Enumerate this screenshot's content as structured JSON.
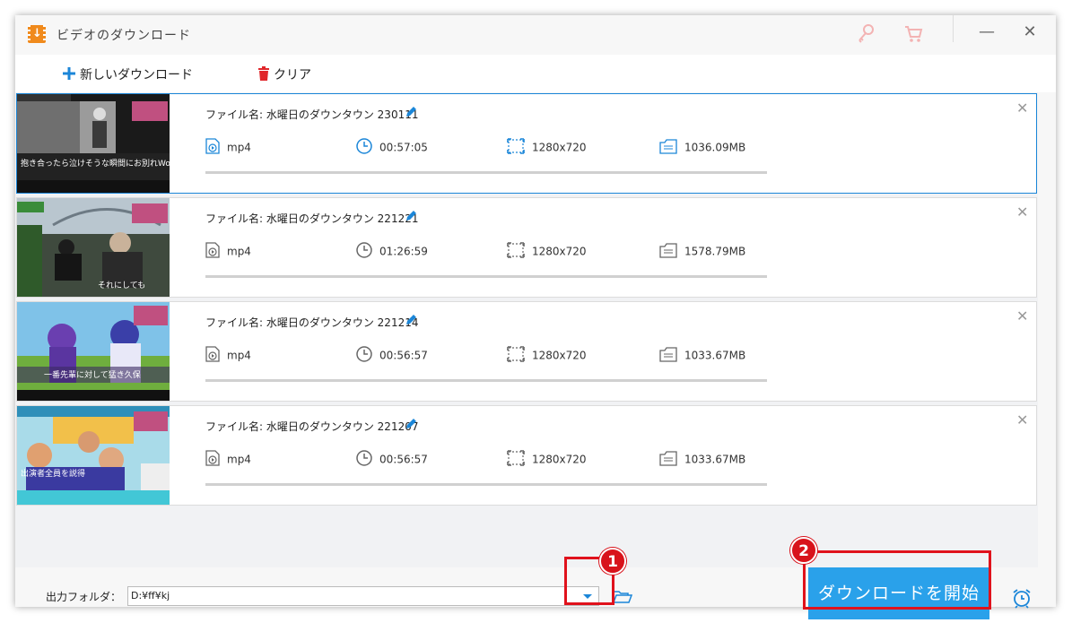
{
  "window": {
    "title": "ビデオのダウンロード",
    "controls": {
      "minimize": "—",
      "close": "✕"
    }
  },
  "toolbar": {
    "new_download_label": "新しいダウンロード",
    "clear_label": "クリア"
  },
  "items": [
    {
      "filename_label": "ファイル名: 水曜日のダウンタウン 230111",
      "format": "mp4",
      "duration": "00:57:05",
      "resolution": "1280x720",
      "size": "1036.09MB",
      "progress": 0,
      "selected": true,
      "thumb_caption": "抱き合ったら泣けそうな瞬間にお別れWow.Wow"
    },
    {
      "filename_label": "ファイル名: 水曜日のダウンタウン 221221",
      "format": "mp4",
      "duration": "01:26:59",
      "resolution": "1280x720",
      "size": "1578.79MB",
      "progress": 0,
      "selected": false,
      "thumb_caption": "それにしても"
    },
    {
      "filename_label": "ファイル名: 水曜日のダウンタウン 221214",
      "format": "mp4",
      "duration": "00:56:57",
      "resolution": "1280x720",
      "size": "1033.67MB",
      "progress": 0,
      "selected": false,
      "thumb_caption": "一番先輩に対して猛き久保"
    },
    {
      "filename_label": "ファイル名: 水曜日のダウンタウン 221207",
      "format": "mp4",
      "duration": "00:56:57",
      "resolution": "1280x720",
      "size": "1033.67MB",
      "progress": 0,
      "selected": false,
      "thumb_caption": "出演者全員を説得"
    }
  ],
  "footer": {
    "output_folder_label": "出力フォルダ：",
    "output_path": "D:¥ff¥kj",
    "download_button_label": "ダウンロードを開始"
  },
  "annotations": {
    "badge_1": "1",
    "badge_2": "2",
    "highlight_color": "#e0121c"
  },
  "colors": {
    "accent": "#2aa1ea",
    "selected_border": "#1b86d8",
    "app_icon": "#f08a1c",
    "titlebar_icons": "#f5b4b4"
  },
  "icons": {
    "app": "download-film-icon",
    "key": "key-icon",
    "cart": "cart-icon",
    "add": "plus-icon",
    "clear": "trash-icon",
    "edit": "pencil-icon",
    "format": "video-file-icon",
    "duration": "clock-icon",
    "resolution": "resolution-icon",
    "size": "file-size-icon",
    "folder": "folder-open-icon",
    "alarm": "alarm-clock-icon"
  }
}
